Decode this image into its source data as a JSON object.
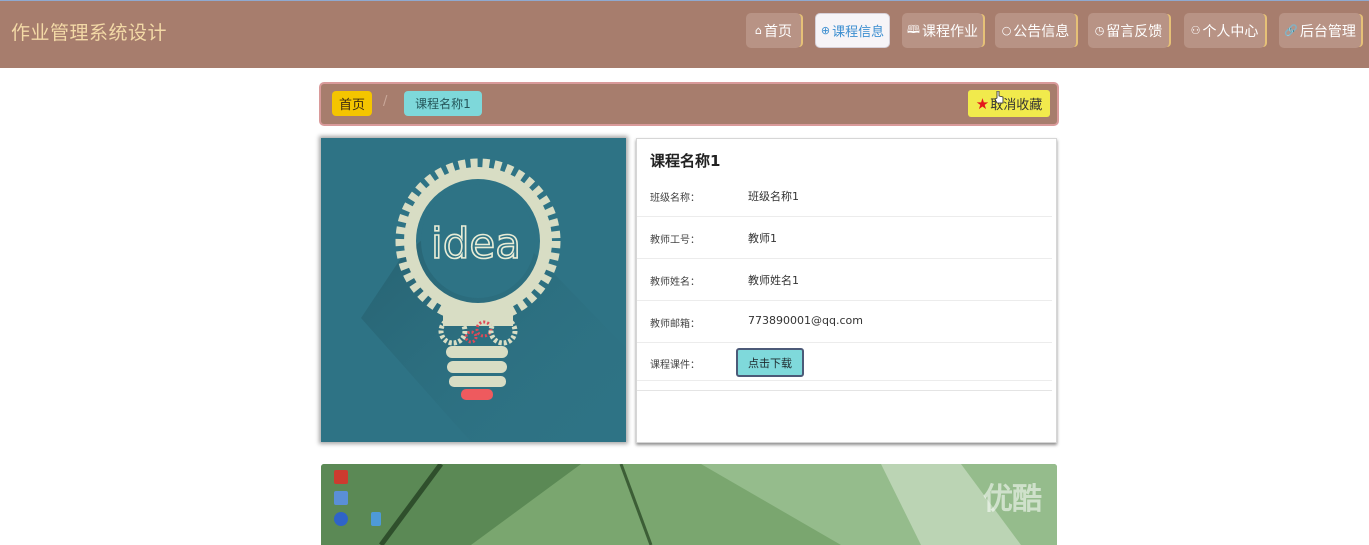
{
  "header": {
    "site_title": "作业管理系统设计",
    "nav": [
      {
        "label": "首页",
        "icon": "home-icon",
        "glyph": "⌂"
      },
      {
        "label": "课程信息",
        "icon": "globe-icon",
        "glyph": "⊕"
      },
      {
        "label": "课程作业",
        "icon": "book-icon",
        "glyph": "🕮"
      },
      {
        "label": "公告信息",
        "icon": "chat-icon",
        "glyph": "○"
      },
      {
        "label": "留言反馈",
        "icon": "clock-icon",
        "glyph": "◷"
      },
      {
        "label": "个人中心",
        "icon": "user-icon",
        "glyph": "⚇"
      },
      {
        "label": "后台管理",
        "icon": "link-icon",
        "glyph": "🔗"
      }
    ],
    "active_nav": "课程信息"
  },
  "breadcrumb": {
    "home": "首页",
    "separator": "/",
    "current": "课程名称1",
    "favorite_label": "取消收藏"
  },
  "course": {
    "cover_text": "idea",
    "name": "课程名称1",
    "fields": [
      {
        "label": "班级名称：",
        "value": "班级名称1"
      },
      {
        "label": "教师工号：",
        "value": "教师1"
      },
      {
        "label": "教师姓名：",
        "value": "教师姓名1"
      },
      {
        "label": "教师邮箱：",
        "value": "773890001@qq.com"
      }
    ],
    "courseware_label": "课程课件：",
    "download_label": "点击下载"
  },
  "video": {
    "watermark": "优酷"
  },
  "colors": {
    "header_bg": "#a77d6d",
    "title_text": "#f3d9a6",
    "home_badge": "#f4c500",
    "current_badge": "#7ed8da",
    "favorite_bg": "#f1ea4c",
    "download_bg": "#7fd9db"
  }
}
